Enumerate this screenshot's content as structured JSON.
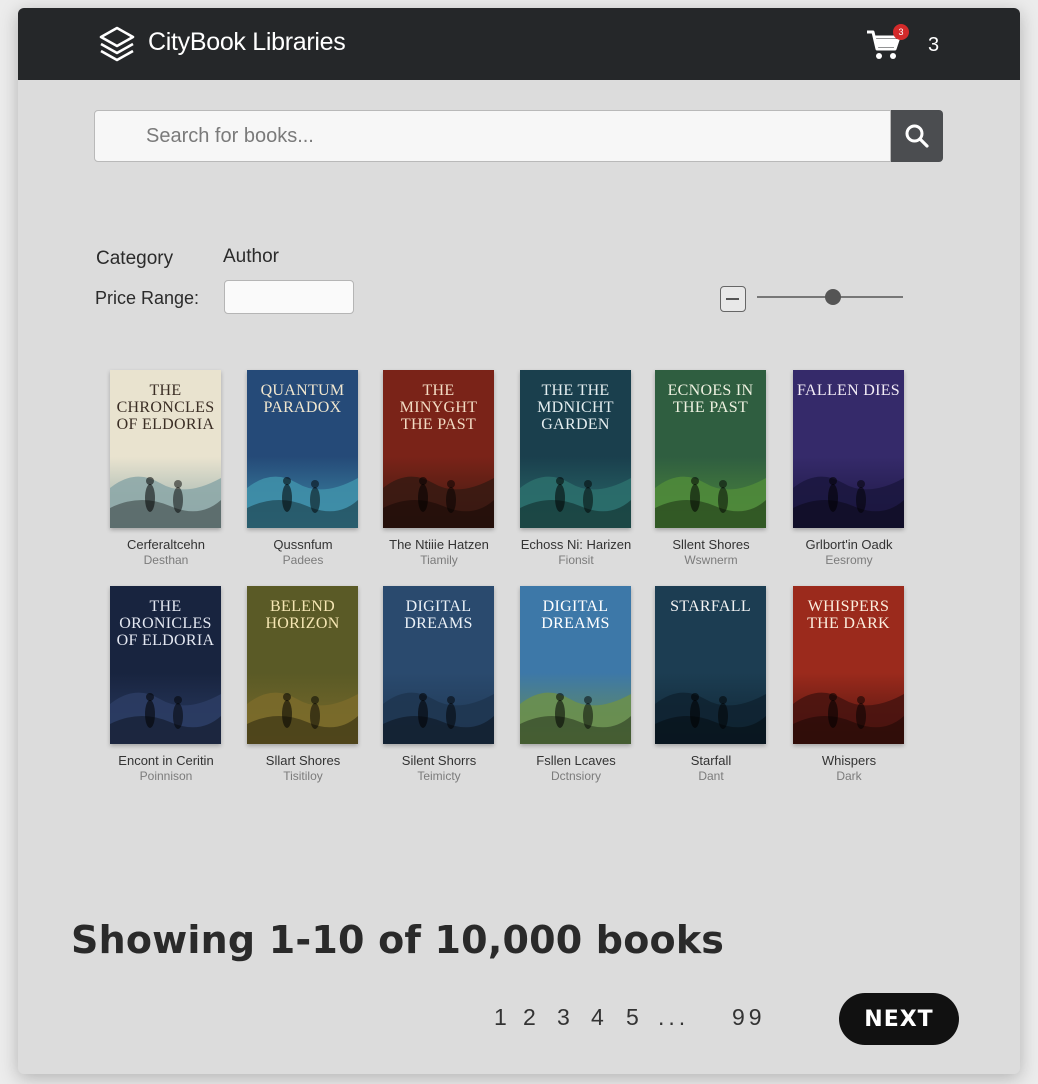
{
  "header": {
    "brand": "CityBook Libraries",
    "cart_badge": "3",
    "cart_count": "3"
  },
  "search": {
    "placeholder": "Search for books..."
  },
  "filters": {
    "category_label": "Category",
    "author_label": "Author",
    "price_label": "Price Range:",
    "price_value": "",
    "slider_level": 0.52
  },
  "books": [
    {
      "cover_text": "The Chroncles of Eldoria",
      "title": "Cerferaltcehn",
      "author": "Desthan",
      "bg": "#e9e3cf",
      "fg": "#3a2d24",
      "art": "#8ea9a8"
    },
    {
      "cover_text": "Quantum Paradox",
      "title": "Qussnfum",
      "author": "Padees",
      "bg": "#254a78",
      "fg": "#f1e7cf",
      "art": "#3f8fa8"
    },
    {
      "cover_text": "The Minyght The Past",
      "title": "The Ntiiie Hatzen",
      "author": "Tiamily",
      "bg": "#7a2318",
      "fg": "#f3dcc4",
      "art": "#3a1a12"
    },
    {
      "cover_text": "The The Mdnicht Garden",
      "title": "Echoss Ni: Harizen",
      "author": "Fionsit",
      "bg": "#1a3f4d",
      "fg": "#e5eef0",
      "art": "#2b6e6b"
    },
    {
      "cover_text": "Ecnoes in the Past",
      "title": "Sllent Shores",
      "author": "Wswnerm",
      "bg": "#2f5e40",
      "fg": "#eef1e0",
      "art": "#4f8a3a"
    },
    {
      "cover_text": "Fallen Dies",
      "title": "Grlbort'in Oadk",
      "author": "Eesromy",
      "bg": "#352a6a",
      "fg": "#f2ecf6",
      "art": "#1c1740"
    },
    {
      "cover_text": "The Oronicles of Eldoria",
      "title": "Encont in Ceritin",
      "author": "Poinnison",
      "bg": "#18243f",
      "fg": "#e3e7f1",
      "art": "#2b3c63"
    },
    {
      "cover_text": "Belend Horizon",
      "title": "Sllart Shores",
      "author": "Tisitiloy",
      "bg": "#5a5a26",
      "fg": "#f5e6b3",
      "art": "#7a6a2a"
    },
    {
      "cover_text": "Digital Dreams",
      "title": "Silent Shorrs",
      "author": "Teimicty",
      "bg": "#2a4a6e",
      "fg": "#eaf0f6",
      "art": "#1f3651"
    },
    {
      "cover_text": "Digital Dreams",
      "title": "Fsllen Lcaves",
      "author": "Dctnsiory",
      "bg": "#3d78a8",
      "fg": "#ffffff",
      "art": "#6a8f4e"
    },
    {
      "cover_text": "Starfall",
      "title": "Starfall",
      "author": "Dant",
      "bg": "#1c3d52",
      "fg": "#f3f3f3",
      "art": "#0f2432"
    },
    {
      "cover_text": "Whispers The Dark",
      "title": "Whispers",
      "author": "Dark",
      "bg": "#9b2a1c",
      "fg": "#fbeede",
      "art": "#4a1410"
    }
  ],
  "results": {
    "showing": "Showing 1-10 of 10,000 books"
  },
  "pagination": {
    "pages": [
      "1",
      "2",
      "3",
      "4",
      "5",
      "...",
      "99"
    ],
    "next_label": "NEXT"
  }
}
